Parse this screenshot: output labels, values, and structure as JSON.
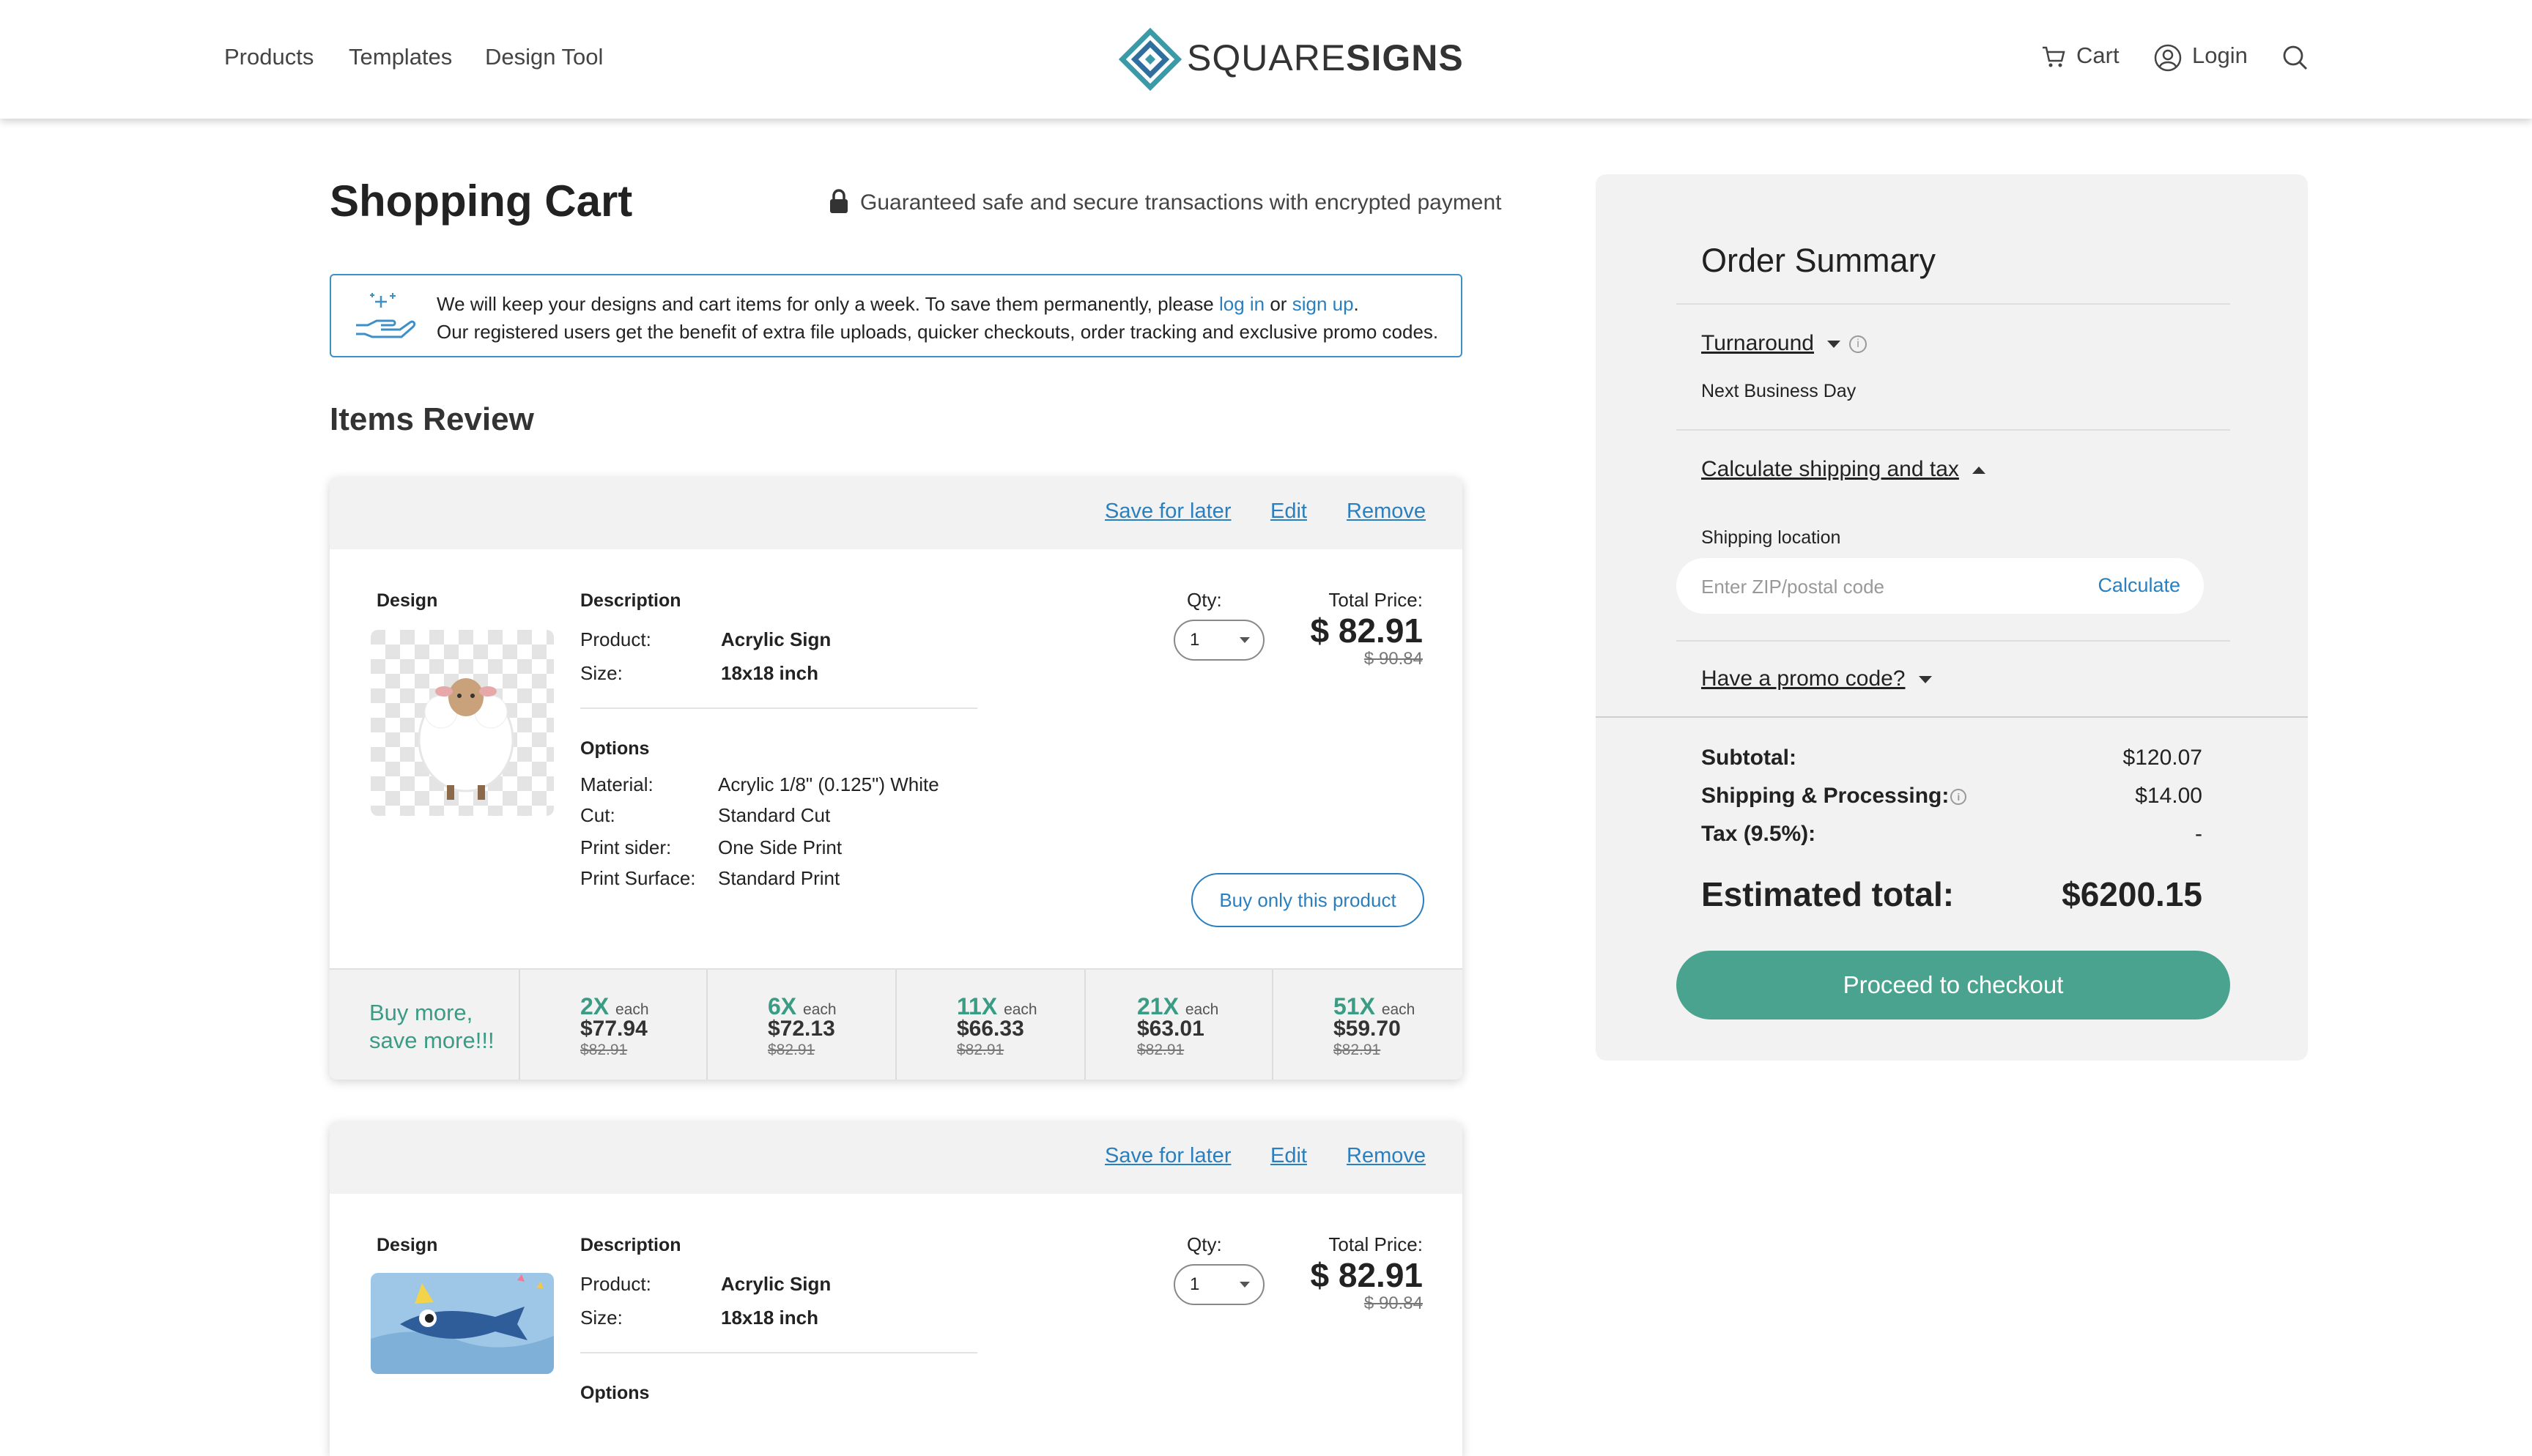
{
  "header": {
    "nav": [
      "Products",
      "Templates",
      "Design Tool"
    ],
    "logo_light": "SQUARE",
    "logo_bold": "SIGNS",
    "cart": "Cart",
    "login": "Login"
  },
  "page": {
    "title": "Shopping Cart",
    "secure_text": "Guaranteed safe and secure transactions with encrypted payment",
    "notice": {
      "line1_pre": "We will keep your designs and cart items for only a week. To save them permanently, please ",
      "login_link": "log in",
      "or": " or ",
      "signup_link": "sign up",
      "line1_post": ".",
      "line2": "Our registered users get the benefit of extra file uploads, quicker checkouts, order tracking and exclusive promo codes."
    },
    "items_title": "Items Review"
  },
  "card_labels": {
    "save_later": "Save for later",
    "edit": "Edit",
    "remove": "Remove",
    "design": "Design",
    "description": "Description",
    "product": "Product:",
    "size": "Size:",
    "options": "Options",
    "material": "Material:",
    "cut": "Cut:",
    "print_sider": "Print sider:",
    "print_surface": "Print Surface:",
    "qty": "Qty:",
    "total_price": "Total Price:",
    "buy_only": "Buy only this product",
    "buy_more": "Buy more,",
    "save_more": "save more!!!",
    "each": "each"
  },
  "items": [
    {
      "product": "Acrylic Sign",
      "size": "18x18 inch",
      "material": "Acrylic 1/8\" (0.125\") White",
      "cut": "Standard Cut",
      "print_sider": "One Side Print",
      "print_surface": "Standard Print",
      "qty": "1",
      "price": "$ 82.91",
      "old_price": "$ 90.84",
      "image": "sheep-design",
      "tiers": [
        {
          "mult": "2X",
          "price": "$77.94",
          "old": "$82.91"
        },
        {
          "mult": "6X",
          "price": "$72.13",
          "old": "$82.91"
        },
        {
          "mult": "11X",
          "price": "$66.33",
          "old": "$82.91"
        },
        {
          "mult": "21X",
          "price": "$63.01",
          "old": "$82.91"
        },
        {
          "mult": "51X",
          "price": "$59.70",
          "old": "$82.91"
        }
      ]
    },
    {
      "product": "Acrylic Sign",
      "size": "18x18 inch",
      "qty": "1",
      "price": "$ 82.91",
      "old_price": "$ 90.84",
      "image": "shark-design"
    }
  ],
  "summary": {
    "title": "Order Summary",
    "turnaround": "Turnaround",
    "turnaround_value": "Next Business Day",
    "calc_shipping": "Calculate shipping and tax",
    "shipping_location": "Shipping location",
    "zip_placeholder": "Enter ZIP/postal code",
    "calculate": "Calculate",
    "promo": "Have a promo code?",
    "subtotal_label": "Subtotal:",
    "subtotal": "$120.07",
    "shipping_label": "Shipping & Processing:",
    "shipping": "$14.00",
    "tax_label": "Tax (9.5%):",
    "tax": "-",
    "estimated_label": "Estimated total:",
    "estimated": "$6200.15",
    "checkout": "Proceed to checkout"
  },
  "colors": {
    "accent_teal": "#4aa38f",
    "link_blue": "#2a7fbf",
    "logo_teal": "#3a9aa8"
  }
}
